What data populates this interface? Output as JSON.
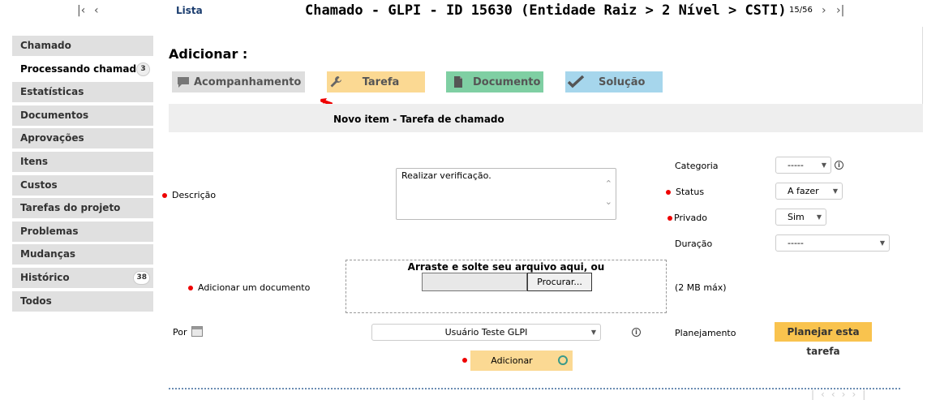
{
  "topbar": {
    "list_label": "Lista",
    "title": "Chamado - GLPI - ID 15630 (Entidade Raiz > 2 Nível > CSTI)",
    "pager_count": "15/56"
  },
  "sidebar": {
    "items": [
      {
        "label": "Chamado",
        "badge": ""
      },
      {
        "label": "Processando chamado",
        "badge": "3"
      },
      {
        "label": "Estatísticas",
        "badge": ""
      },
      {
        "label": "Documentos",
        "badge": ""
      },
      {
        "label": "Aprovações",
        "badge": ""
      },
      {
        "label": "Itens",
        "badge": ""
      },
      {
        "label": "Custos",
        "badge": ""
      },
      {
        "label": "Tarefas do projeto",
        "badge": ""
      },
      {
        "label": "Problemas",
        "badge": ""
      },
      {
        "label": "Mudanças",
        "badge": ""
      },
      {
        "label": "Histórico",
        "badge": "38"
      },
      {
        "label": "Todos",
        "badge": ""
      }
    ]
  },
  "main": {
    "add_title": "Adicionar :",
    "actions": {
      "acompanhamento": "Acompanhamento",
      "tarefa": "Tarefa",
      "documento": "Documento",
      "solucao": "Solução"
    },
    "section_title": "Novo item - Tarefa de chamado",
    "form": {
      "descricao_label": "Descrição",
      "descricao_value": "Realizar verificação.",
      "categoria_label": "Categoria",
      "categoria_value": "-----",
      "status_label": "Status",
      "status_value": "A fazer",
      "privado_label": "Privado",
      "privado_value": "Sim",
      "duracao_label": "Duração",
      "duracao_value": "-----",
      "documento_label": "Adicionar um documento",
      "drop_text": "Arraste e solte seu arquivo aqui, ou",
      "browse_label": "Procurar...",
      "max_size": "(2 MB máx)",
      "por_label": "Por",
      "user_value": "Usuário Teste GLPI",
      "planejamento_label": "Planejamento",
      "planejar_button": "Planejar esta tarefa",
      "submit_button": "Adicionar"
    }
  },
  "colors": {
    "acompanhamento": "#dedede",
    "tarefa": "#fbd993",
    "documento": "#7fcfa3",
    "solucao": "#a6d6ec",
    "planejar": "#f9c34e",
    "required": "#ee0000"
  }
}
